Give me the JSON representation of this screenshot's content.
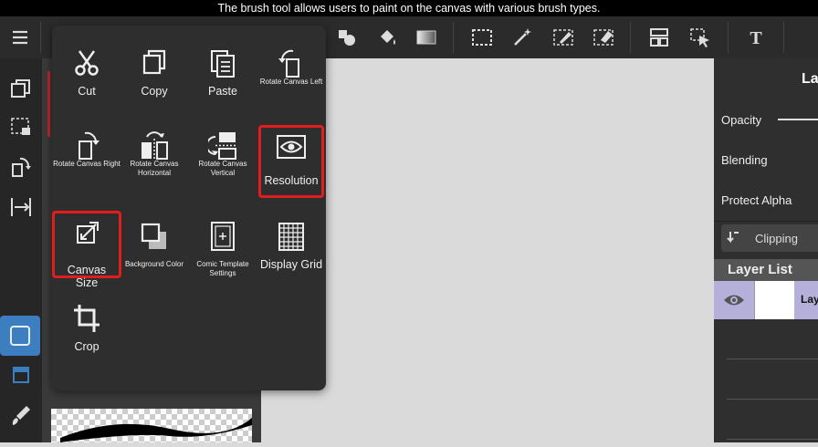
{
  "caption": "The brush tool allows users to paint on the canvas with various brush types.",
  "toolbar": {
    "icons": [
      "menu-icon",
      "shapes-icon",
      "fill-bucket-icon",
      "gradient-icon",
      "selection-rect-icon",
      "magic-wand-icon",
      "select-pen-icon",
      "select-eraser-icon",
      "layout-icon",
      "move-select-icon",
      "text-icon"
    ]
  },
  "menu": {
    "items": [
      {
        "label": "Cut",
        "icon": "scissors-icon"
      },
      {
        "label": "Copy",
        "icon": "copy-icon"
      },
      {
        "label": "Paste",
        "icon": "paste-icon"
      },
      {
        "label": "Rotate Canvas Left",
        "icon": "rotate-left-icon"
      },
      {
        "label": "Rotate Canvas Right",
        "icon": "rotate-right-icon"
      },
      {
        "label": "Rotate Canvas Horizontal",
        "icon": "flip-horizontal-icon"
      },
      {
        "label": "Rotate Canvas Vertical",
        "icon": "flip-vertical-icon"
      },
      {
        "label": "Resolution",
        "icon": "eye-icon",
        "highlighted": true
      },
      {
        "label": "Canvas Size",
        "icon": "canvas-size-icon",
        "highlighted": true
      },
      {
        "label": "Background Color",
        "icon": "background-color-icon"
      },
      {
        "label": "Comic Template Settings",
        "icon": "comic-template-icon"
      },
      {
        "label": "Display Grid",
        "icon": "grid-icon"
      },
      {
        "label": "Crop",
        "icon": "crop-icon"
      }
    ]
  },
  "right_panel": {
    "title": "La",
    "opacity_label": "Opacity",
    "blending_label": "Blending",
    "protect_alpha_label": "Protect Alpha",
    "clipping_label": "Clipping",
    "layer_list_label": "Layer List",
    "layer_name": "Lay"
  },
  "colors": {
    "highlight": "#e21d1d",
    "accent": "#3d7ec0",
    "layer_selected": "#b4b0d9"
  }
}
